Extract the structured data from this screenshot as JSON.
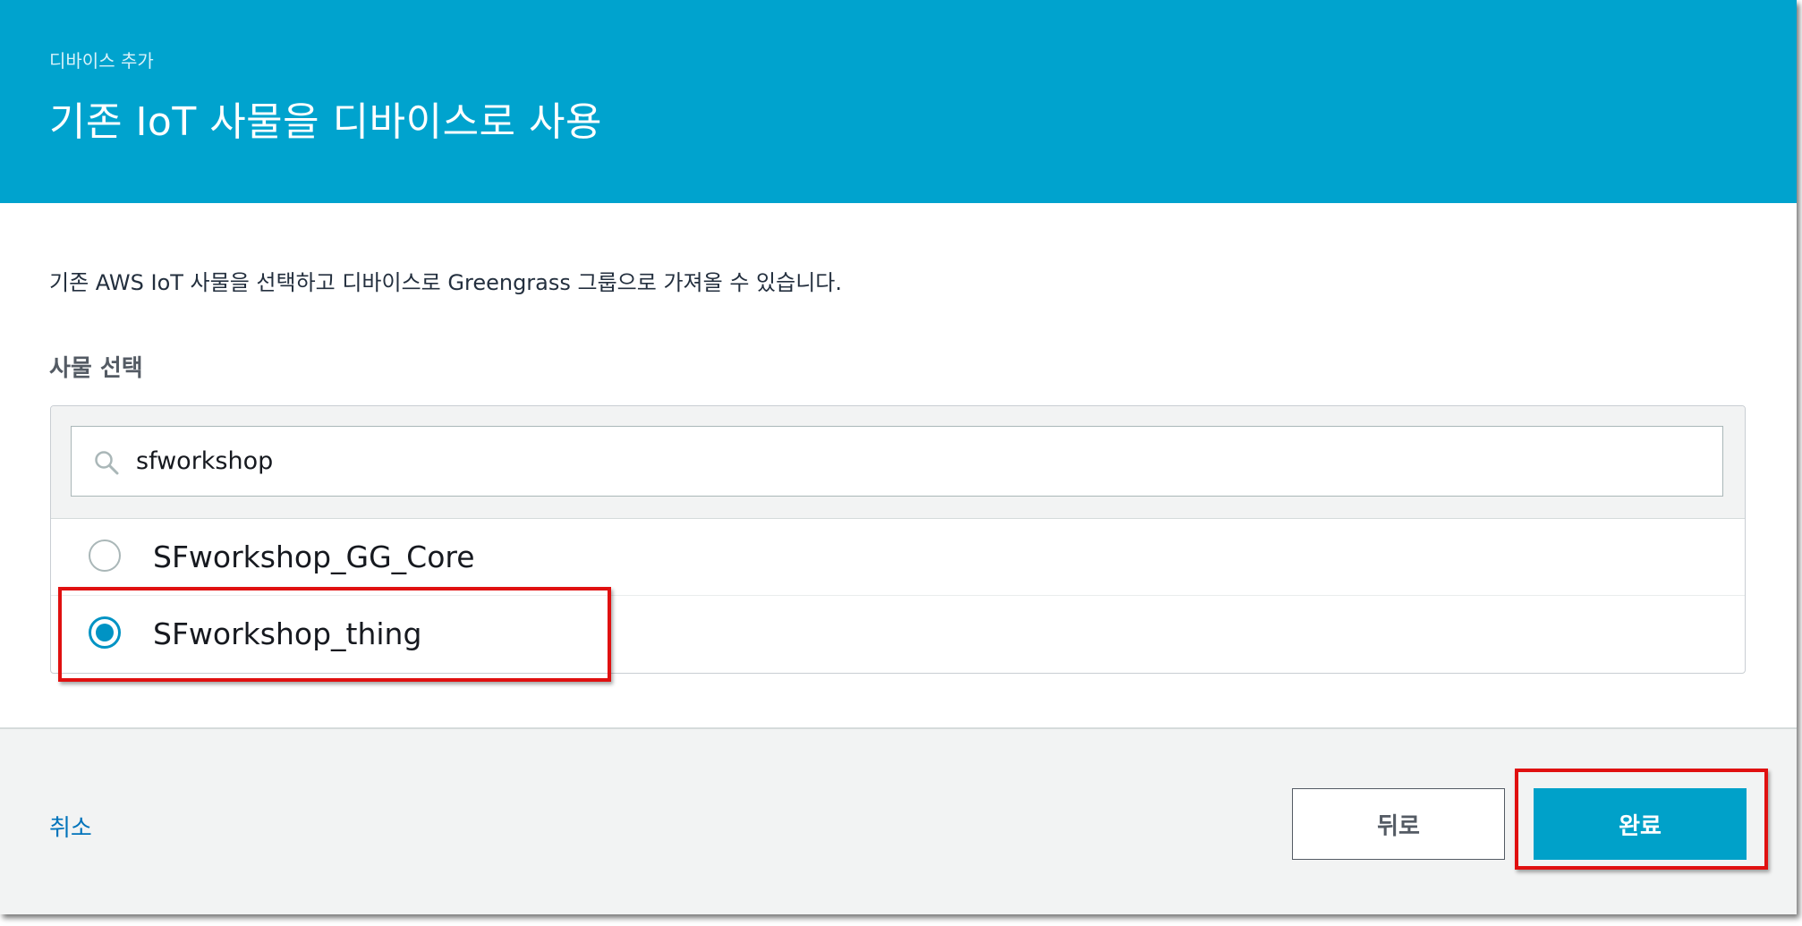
{
  "header": {
    "subtitle": "디바이스 추가",
    "title": "기존 IoT 사물을 디바이스로 사용"
  },
  "main": {
    "description": "기존 AWS IoT 사물을 선택하고 디바이스로 Greengrass 그룹으로 가져올 수 있습니다.",
    "field_label": "사물 선택",
    "search": {
      "value": "sfworkshop",
      "icon": "search-icon"
    },
    "options": [
      {
        "label": "SFworkshop_GG_Core",
        "selected": false
      },
      {
        "label": "SFworkshop_thing",
        "selected": true
      }
    ]
  },
  "footer": {
    "cancel_label": "취소",
    "back_label": "뒤로",
    "finish_label": "완료"
  },
  "colors": {
    "header_bg": "#00a3ce",
    "primary_button": "#00a1c9",
    "radio_selected": "#0093c4",
    "link": "#0073bb",
    "annotation_red": "#e01010"
  }
}
